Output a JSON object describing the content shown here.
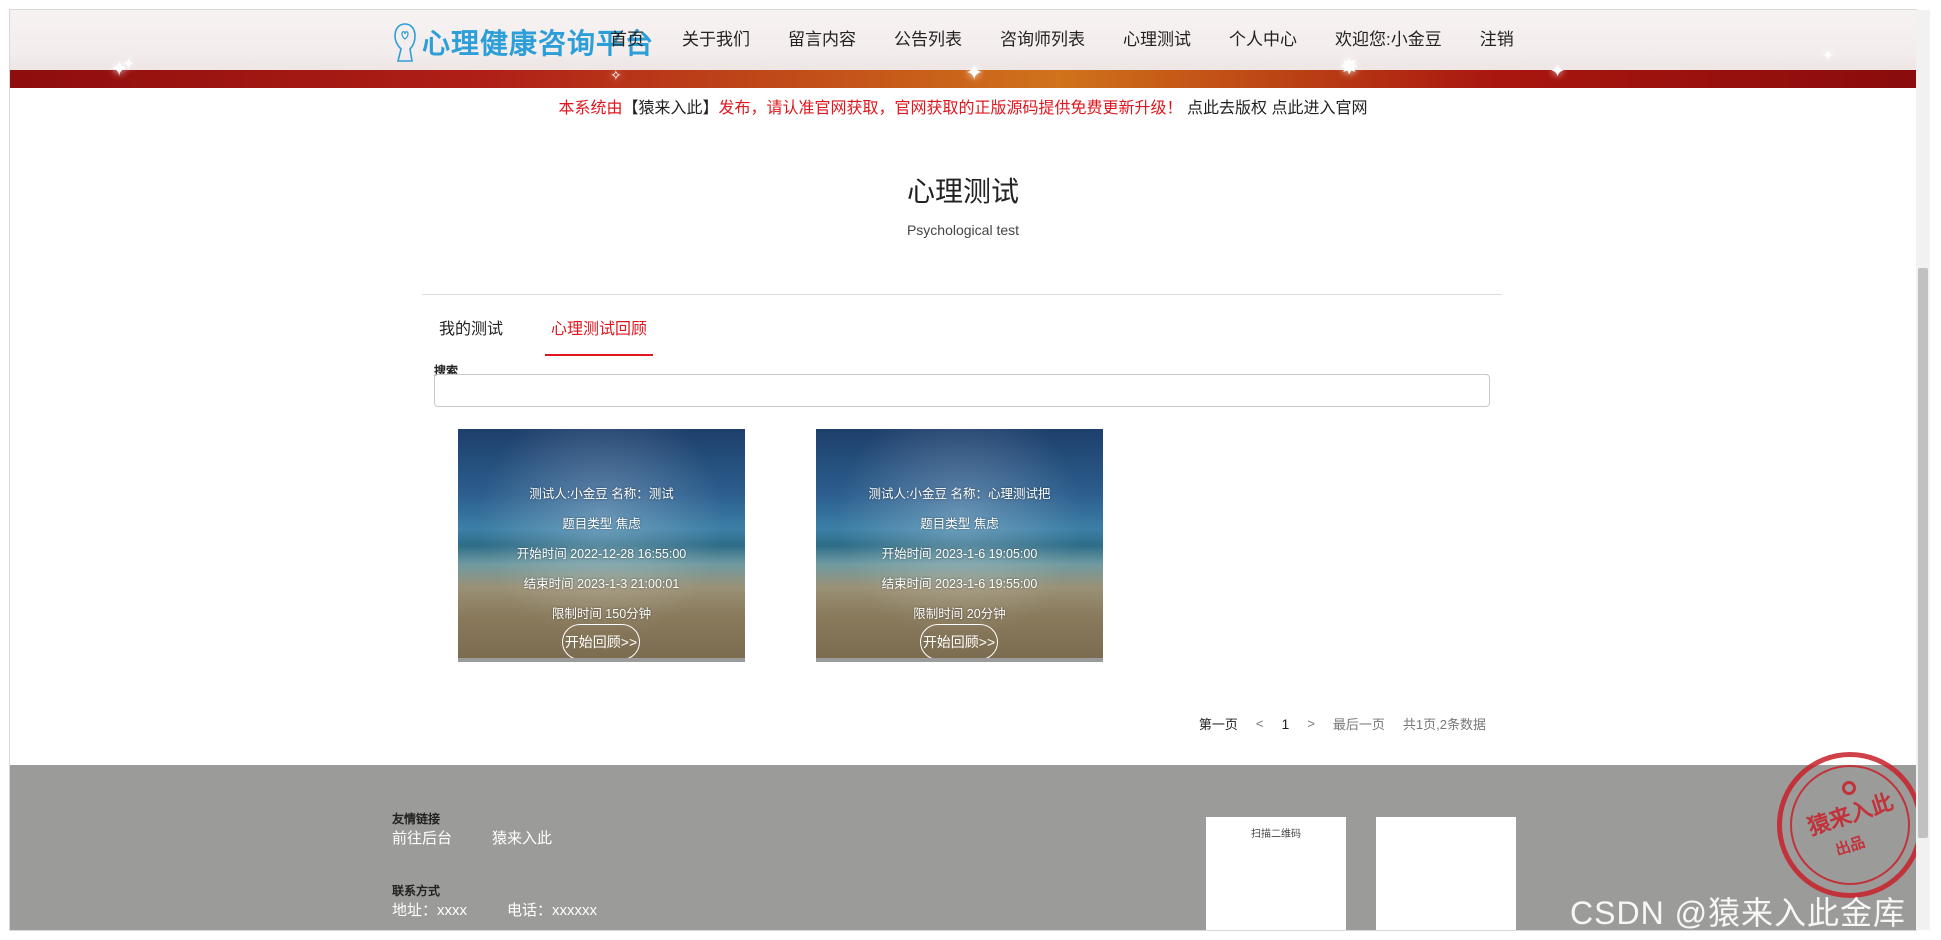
{
  "header": {
    "logo_text": "心理健康咨询平台",
    "nav": [
      "首页",
      "关于我们",
      "留言内容",
      "公告列表",
      "咨询师列表",
      "心理测试",
      "个人中心",
      "欢迎您:小金豆",
      "注销"
    ]
  },
  "notice": {
    "part1": "本系统由",
    "part2": "【猿来入此】",
    "part3": "发布，请认准官网获取，官网获取的正版源码提供免费更新升级！",
    "part4": " 点此去版权 点此进入官网"
  },
  "page": {
    "title": "心理测试",
    "subtitle": "Psychological test"
  },
  "tabs": {
    "items": [
      "我的测试",
      "心理测试回顾"
    ],
    "active_index": 1
  },
  "search": {
    "label": "搜索",
    "value": "",
    "placeholder": ""
  },
  "cards": [
    {
      "line1": "测试人:小金豆 名称：测试",
      "line2": "题目类型 焦虑",
      "line3": "开始时间 2022-12-28 16:55:00",
      "line4": "结束时间 2023-1-3 21:00:01",
      "line5": "限制时间 150分钟",
      "button": "开始回顾>>"
    },
    {
      "line1": "测试人:小金豆 名称：心理测试把",
      "line2": "题目类型 焦虑",
      "line3": "开始时间 2023-1-6 19:05:00",
      "line4": "结束时间 2023-1-6 19:55:00",
      "line5": "限制时间 20分钟",
      "button": "开始回顾>>"
    }
  ],
  "pagination": {
    "first": "第一页",
    "prev": "<",
    "current": "1",
    "next": ">",
    "last": "最后一页",
    "summary": "共1页,2条数据"
  },
  "footer": {
    "links_heading": "友情链接",
    "links": [
      "前往后台",
      "猿来入此"
    ],
    "contact_heading": "联系方式",
    "address": "地址：xxxx",
    "phone": "电话：xxxxxx",
    "qr_label": "扫描二维码"
  },
  "stamp": {
    "text": "猿来入此",
    "sub": "出品"
  },
  "watermark": "CSDN @猿来入此金库",
  "colors": {
    "accent_red": "#e0161e",
    "logo_blue": "#2d9fd8",
    "footer_gray": "#9b9b99"
  }
}
